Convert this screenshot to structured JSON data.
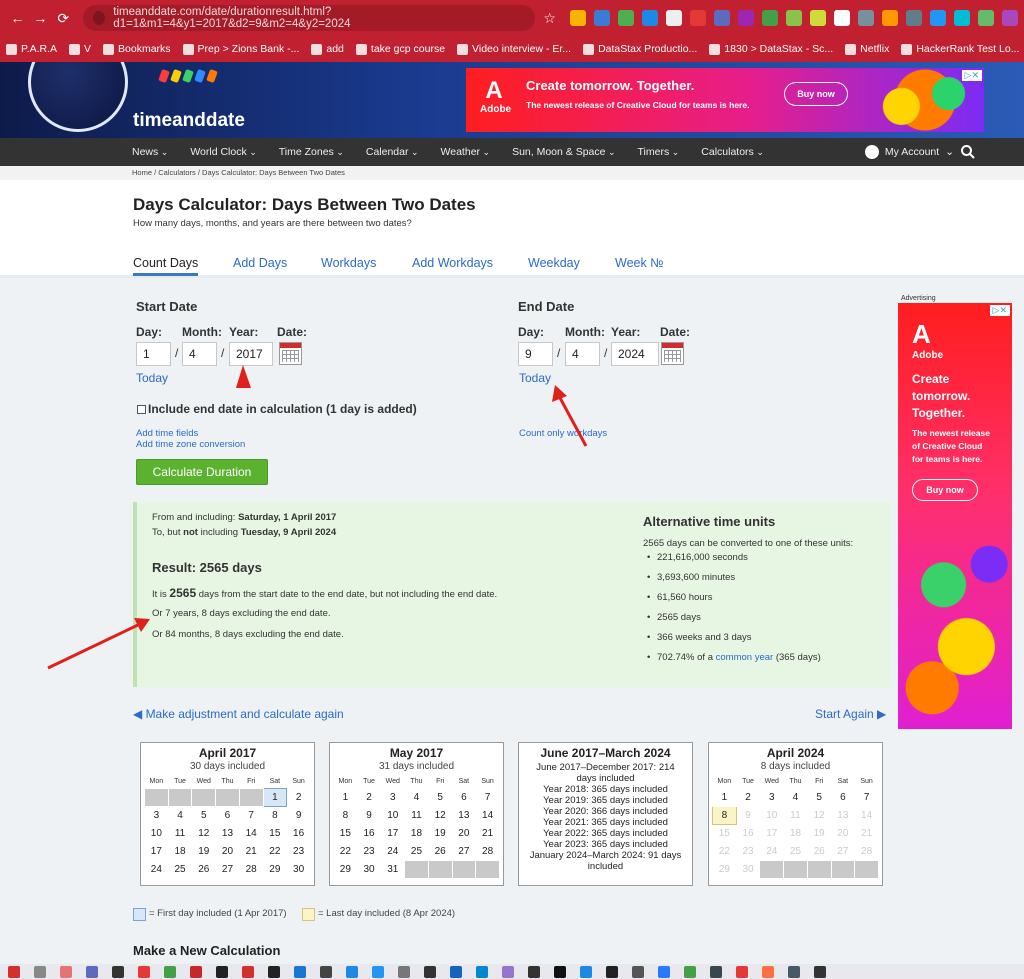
{
  "browser": {
    "url": "timeanddate.com/date/durationresult.html?d1=1&m1=4&y1=2017&d2=9&m2=4&y2=2024",
    "bookmarks": [
      "P.A.R.A",
      "V",
      "Bookmarks",
      "Prep > Zions Bank -...",
      "add",
      "take gcp course",
      "Video interview - Er...",
      "DataStax Productio...",
      "1830 > DataStax - Sc...",
      "Netflix",
      "HackerRank Test Lo..."
    ]
  },
  "site": {
    "logo": "timeanddate",
    "ad_banner": {
      "brand": "Adobe",
      "title": "Create tomorrow. Together.",
      "sub": "The newest release of Creative Cloud for teams is here.",
      "button": "Buy now"
    },
    "nav": [
      "News",
      "World Clock",
      "Time Zones",
      "Calendar",
      "Weather",
      "Sun, Moon & Space",
      "Timers",
      "Calculators"
    ],
    "account": "My Account",
    "breadcrumb": "Home /  Calculators /  Days Calculator: Days Between Two Dates"
  },
  "page": {
    "title": "Days Calculator: Days Between Two Dates",
    "subtitle": "How many days, months, and years are there between two dates?",
    "tabs": [
      "Count Days",
      "Add Days",
      "Workdays",
      "Add Workdays",
      "Weekday",
      "Week №"
    ]
  },
  "form": {
    "start": {
      "heading": "Start Date",
      "day": "1",
      "month": "4",
      "year": "2017",
      "today": "Today"
    },
    "end": {
      "heading": "End Date",
      "day": "9",
      "month": "4",
      "year": "2024",
      "today": "Today"
    },
    "labels": {
      "day": "Day:",
      "month": "Month:",
      "year": "Year:",
      "date": "Date:"
    },
    "include_end": "Include end date in calculation (1 day is added)",
    "add_time": "Add time fields",
    "add_tz": "Add time zone conversion",
    "count_workdays": "Count only workdays",
    "calculate": "Calculate Duration"
  },
  "result": {
    "from_prefix": "From and including:",
    "from_value": "Saturday, 1 April 2017",
    "to_prefix": "To, but",
    "to_not": "not",
    "to_mid": "including",
    "to_value": "Tuesday, 9 April 2024",
    "heading": "Result: 2565 days",
    "line1_pre": "It is",
    "line1_num": "2565",
    "line1_post": "days from the start date to the end date, but not including the end date.",
    "line2": "Or 7 years, 8 days excluding the end date.",
    "line3": "Or 84 months, 8 days excluding the end date.",
    "alt_heading": "Alternative time units",
    "alt_intro": "2565 days can be converted to one of these units:",
    "alt_units": [
      "221,616,000 seconds",
      "3,693,600 minutes",
      "61,560 hours",
      "2565 days",
      "366 weeks and 3 days"
    ],
    "alt_last_pre": "702.74% of a",
    "alt_last_link": "common year",
    "alt_last_post": "(365 days)"
  },
  "links": {
    "adjust": "◀ Make adjustment and calculate again",
    "start_again": "Start Again ▶"
  },
  "calendars": {
    "weekdays": [
      "Mon",
      "Tue",
      "Wed",
      "Thu",
      "Fri",
      "Sat",
      "Sun"
    ],
    "april2017": {
      "title": "April 2017",
      "sub": "30 days included"
    },
    "may2017": {
      "title": "May 2017",
      "sub": "31 days included"
    },
    "summary": {
      "title": "June 2017–March 2024",
      "lines": [
        "June 2017–December 2017: 214",
        "days included",
        "Year 2018: 365 days included",
        "Year 2019: 365 days included",
        "Year 2020: 366 days included",
        "Year 2021: 365 days included",
        "Year 2022: 365 days included",
        "Year 2023: 365 days included",
        "January 2024–March 2024: 91 days",
        "included"
      ]
    },
    "april2024": {
      "title": "April 2024",
      "sub": "8 days included"
    }
  },
  "legend": {
    "first": "= First day included (1 Apr 2017)",
    "last": "= Last day included (8 Apr 2024)"
  },
  "side_ad": {
    "label": "Advertising",
    "brand": "Adobe",
    "title1": "Create",
    "title2": "tomorrow.",
    "title3": "Together.",
    "sub1": "The newest release",
    "sub2": "of Creative Cloud",
    "sub3": "for teams is here.",
    "button": "Buy now"
  },
  "new_calc": "Make a New Calculation"
}
